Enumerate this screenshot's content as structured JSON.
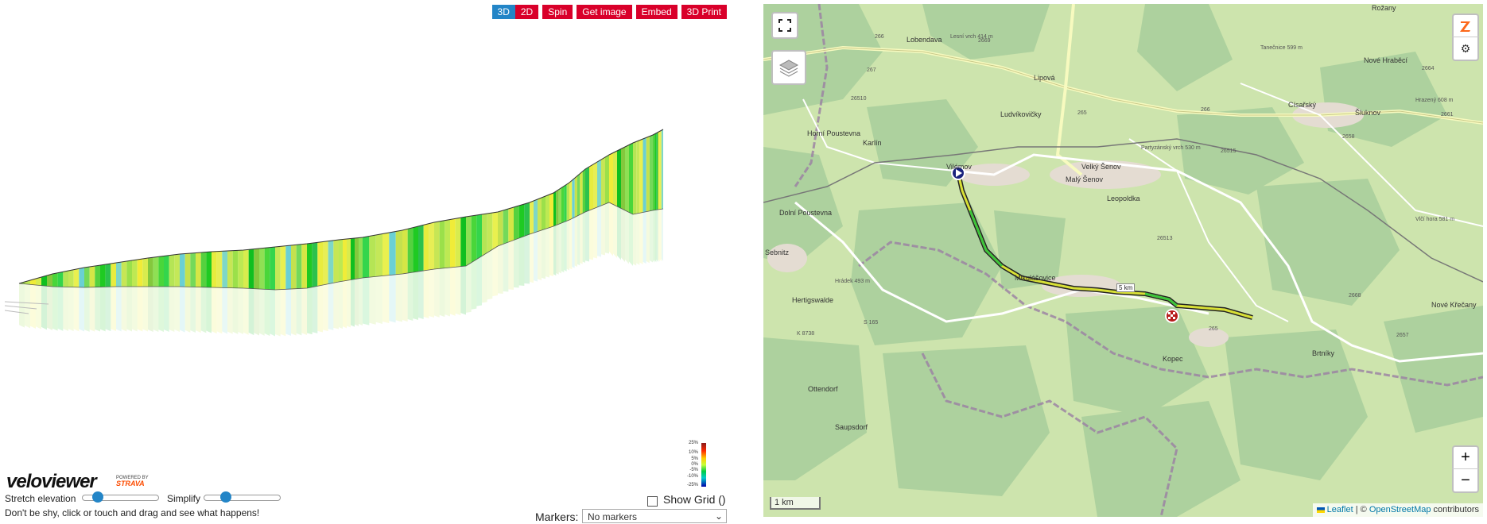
{
  "toolbar": {
    "btn_3d": "3D",
    "btn_2d": "2D",
    "btn_spin": "Spin",
    "btn_get_image": "Get image",
    "btn_embed": "Embed",
    "btn_3d_print": "3D Print"
  },
  "controls": {
    "stretch_label": "Stretch elevation",
    "simplify_label": "Simplify",
    "show_grid_label": "Show Grid ()",
    "shy_text": "Don't be shy, click or touch and drag and see what happens!",
    "markers_label": "Markers:",
    "markers_value": "No markers"
  },
  "branding": {
    "logo_velo": "velo",
    "logo_viewer": "viewer",
    "powered_by": "POWERED BY",
    "strava": "STRAVA"
  },
  "gradient_legend": {
    "labels": [
      "25%",
      "10%",
      "5%",
      "0%",
      "-5%",
      "-10%",
      "-25%"
    ],
    "colors": [
      "#8b1a1a",
      "#ff2a00",
      "#ffcc00",
      "#c6ff3a",
      "#00cc44",
      "#00cccc",
      "#0000aa"
    ]
  },
  "map": {
    "scale_label": "1 km",
    "attribution_leaflet": "Leaflet",
    "attribution_sep": " | © ",
    "attribution_osm": "OpenStreetMap",
    "attribution_tail": " contributors",
    "km_marker": "5 km",
    "zoom_in": "+",
    "zoom_out": "−",
    "towns": [
      {
        "name": "Lobendava"
      },
      {
        "name": "Lipová"
      },
      {
        "name": "Horní Poustevna"
      },
      {
        "name": "Karlín"
      },
      {
        "name": "Vilémov"
      },
      {
        "name": "Dolní Poustevna"
      },
      {
        "name": "Sebnitz"
      },
      {
        "name": "Hertigswalde"
      },
      {
        "name": "Velký Šenov"
      },
      {
        "name": "Malý Šenov"
      },
      {
        "name": "Leopoldka"
      },
      {
        "name": "Ludvíkovičky"
      },
      {
        "name": "Mikulášovice"
      },
      {
        "name": "Šluknov"
      },
      {
        "name": "Císařský"
      },
      {
        "name": "Rožany"
      },
      {
        "name": "Nové Hraběcí"
      },
      {
        "name": "Brtníky"
      },
      {
        "name": "Kopec"
      },
      {
        "name": "Saupsdorf"
      },
      {
        "name": "Ottendorf"
      },
      {
        "name": "Nové Křečany"
      }
    ],
    "roads": [
      "266",
      "267",
      "2669",
      "265",
      "266",
      "26515",
      "2661",
      "2658",
      "2664",
      "26513",
      "26510",
      "265",
      "2668",
      "2657",
      "S 165",
      "K 8738"
    ],
    "peaks": [
      {
        "name": "Lesní vrch",
        "ele": "414 m"
      },
      {
        "name": "Hrazený",
        "ele": "608 m"
      },
      {
        "name": "Partyzánský vrch",
        "ele": "530 m"
      },
      {
        "name": "Tanečnice",
        "ele": "599 m"
      },
      {
        "name": "Vlčí hora",
        "ele": "581 m"
      },
      {
        "name": "Hrádek",
        "ele": "493 m"
      }
    ]
  }
}
